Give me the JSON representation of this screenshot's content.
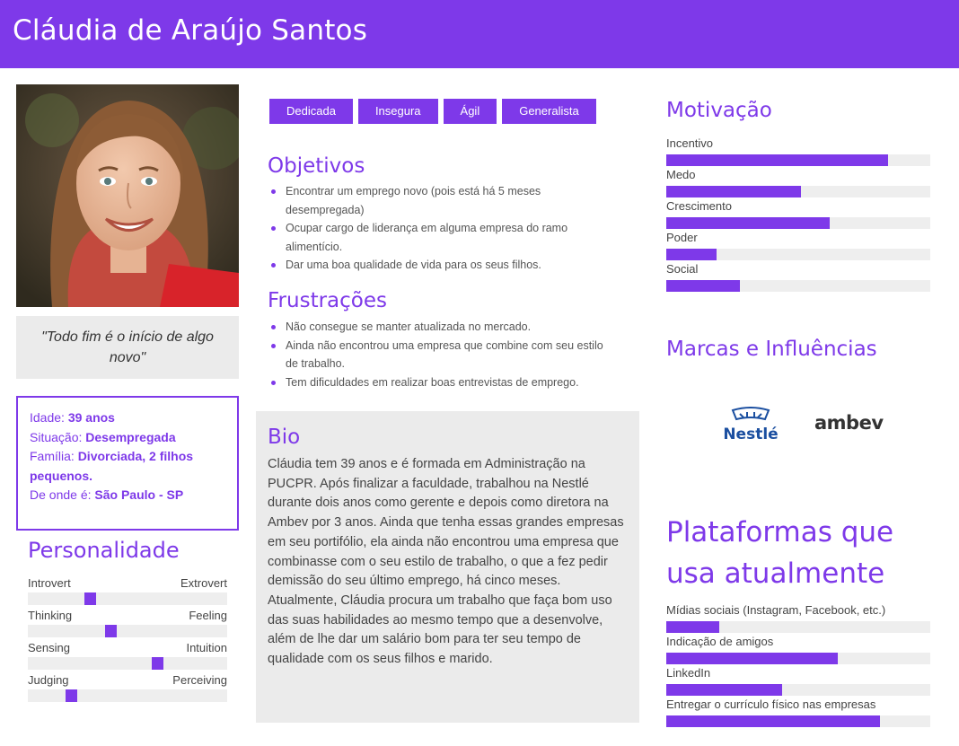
{
  "header": {
    "name": "Cláudia de Araújo Santos"
  },
  "quote": "\"Todo fim é o início de algo novo\"",
  "info": {
    "age_label": "Idade:",
    "age_value": "39 anos",
    "status_label": "Situação:",
    "status_value": "Desempregada",
    "family_label": "Família:",
    "family_value": "Divorciada, 2 filhos pequenos.",
    "origin_label": "De onde é:",
    "origin_value": "São Paulo - SP"
  },
  "personality": {
    "title": "Personalidade",
    "traits": [
      {
        "left": "Introvert",
        "right": "Extrovert",
        "level": 0.3
      },
      {
        "left": "Thinking",
        "right": "Feeling",
        "level": 0.41
      },
      {
        "left": "Sensing",
        "right": "Intuition",
        "level": 0.66
      },
      {
        "left": "Judging",
        "right": "Perceiving",
        "level": 0.2
      }
    ]
  },
  "tags": [
    "Dedicada",
    "Insegura",
    "Ágil",
    "Generalista"
  ],
  "objectives": {
    "title": "Objetivos",
    "items": [
      "Encontrar um emprego novo (pois está há 5 meses desempregada)",
      "Ocupar cargo de liderança em alguma empresa do ramo alimentício.",
      "Dar uma boa qualidade de vida para os seus filhos."
    ]
  },
  "frustrations": {
    "title": "Frustrações",
    "items": [
      "Não consegue se manter atualizada no mercado.",
      "Ainda não encontrou uma empresa que combine com seu estilo de trabalho.",
      "Tem dificuldades em realizar boas entrevistas de emprego."
    ]
  },
  "bio": {
    "title": "Bio",
    "paragraph1": "Cláudia tem 39 anos e é formada em Administração na PUCPR. Após finalizar a faculdade, trabalhou na Nestlé durante dois anos como gerente e depois como diretora na Ambev por 3 anos. Ainda que tenha essas grandes empresas em seu portifólio, ela ainda não encontrou uma empresa que combinasse com o seu estilo de trabalho, o que a fez pedir demissão do seu último emprego, há cinco meses.",
    "paragraph2": "Atualmente, Cláudia procura um trabalho que faça bom uso das suas habilidades ao mesmo tempo que a desenvolve, além de lhe dar um salário bom para ter seu tempo de qualidade com os seus filhos e marido."
  },
  "motivation": {
    "title": "Motivação",
    "items": [
      {
        "label": "Incentivo",
        "level": 0.84
      },
      {
        "label": "Medo",
        "level": 0.51
      },
      {
        "label": "Crescimento",
        "level": 0.62
      },
      {
        "label": "Poder",
        "level": 0.19
      },
      {
        "label": "Social",
        "level": 0.28
      }
    ]
  },
  "brands": {
    "title": "Marcas e Influências",
    "logos": [
      {
        "name": "Nestlé",
        "icon": "nestle-logo",
        "color": "#1b4fa0"
      },
      {
        "name": "ambev",
        "icon": "ambev-logo",
        "color": "#333333"
      }
    ]
  },
  "platforms": {
    "title": "Plataformas que usa atualmente",
    "items": [
      {
        "label": "Mídias sociais (Instagram, Facebook, etc.)",
        "level": 0.2
      },
      {
        "label": "Indicação de amigos",
        "level": 0.65
      },
      {
        "label": "LinkedIn",
        "level": 0.44
      },
      {
        "label": "Entregar o currículo físico nas empresas",
        "level": 0.81
      }
    ]
  },
  "colors": {
    "accent": "#7e39e9",
    "panel": "#ebebeb",
    "track": "#eeeeee"
  }
}
